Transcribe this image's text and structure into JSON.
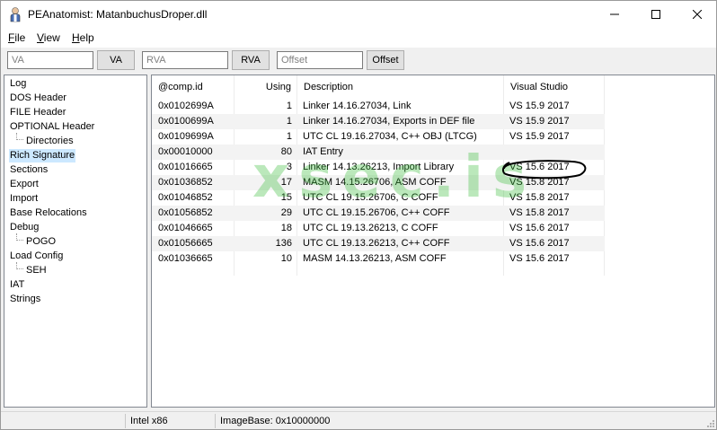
{
  "window": {
    "title": "PEAnatomist: MatanbuchusDroper.dll"
  },
  "menu": {
    "file": {
      "first": "F",
      "rest": "ile"
    },
    "view": {
      "first": "V",
      "rest": "iew"
    },
    "help": {
      "first": "H",
      "rest": "elp"
    }
  },
  "toolbar": {
    "va_placeholder": "VA",
    "va_button": "VA",
    "rva_placeholder": "RVA",
    "rva_button": "RVA",
    "offset_placeholder": "Offset",
    "offset_button": "Offset"
  },
  "tree": {
    "items": [
      {
        "label": "Log"
      },
      {
        "label": "DOS Header"
      },
      {
        "label": "FILE Header"
      },
      {
        "label": "OPTIONAL Header"
      },
      {
        "label": "Directories"
      },
      {
        "label": "Rich Signature"
      },
      {
        "label": "Sections"
      },
      {
        "label": "Export"
      },
      {
        "label": "Import"
      },
      {
        "label": "Base Relocations"
      },
      {
        "label": "Debug"
      },
      {
        "label": "POGO"
      },
      {
        "label": "Load Config"
      },
      {
        "label": "SEH"
      },
      {
        "label": "IAT"
      },
      {
        "label": "Strings"
      }
    ],
    "selected": "Rich Signature"
  },
  "table": {
    "columns": [
      "@comp.id",
      "Using",
      "Description",
      "Visual Studio"
    ],
    "rows": [
      {
        "compid": "0x0102699A",
        "using": "1",
        "description": "Linker 14.16.27034, Link",
        "vs": "VS 15.9 2017"
      },
      {
        "compid": "0x0100699A",
        "using": "1",
        "description": "Linker 14.16.27034, Exports in DEF file",
        "vs": "VS 15.9 2017"
      },
      {
        "compid": "0x0109699A",
        "using": "1",
        "description": "UTC CL 19.16.27034, C++ OBJ (LTCG)",
        "vs": "VS 15.9 2017"
      },
      {
        "compid": "0x00010000",
        "using": "80",
        "description": "IAT Entry",
        "vs": ""
      },
      {
        "compid": "0x01016665",
        "using": "3",
        "description": "Linker 14.13.26213, Import Library",
        "vs": "VS 15.6 2017"
      },
      {
        "compid": "0x01036852",
        "using": "17",
        "description": "MASM 14.15.26706, ASM COFF",
        "vs": "VS 15.8 2017"
      },
      {
        "compid": "0x01046852",
        "using": "15",
        "description": "UTC CL 19.15.26706, C COFF",
        "vs": "VS 15.8 2017"
      },
      {
        "compid": "0x01056852",
        "using": "29",
        "description": "UTC CL 19.15.26706, C++ COFF",
        "vs": "VS 15.8 2017"
      },
      {
        "compid": "0x01046665",
        "using": "18",
        "description": "UTC CL 19.13.26213, C COFF",
        "vs": "VS 15.6 2017"
      },
      {
        "compid": "0x01056665",
        "using": "136",
        "description": "UTC CL 19.13.26213, C++ COFF",
        "vs": "VS 15.6 2017"
      },
      {
        "compid": "0x01036665",
        "using": "10",
        "description": "MASM 14.13.26213, ASM COFF",
        "vs": "VS 15.6 2017"
      }
    ]
  },
  "watermark": "xsec.is",
  "status": {
    "arch": "Intel x86",
    "imagebase": "ImageBase: 0x10000000"
  }
}
